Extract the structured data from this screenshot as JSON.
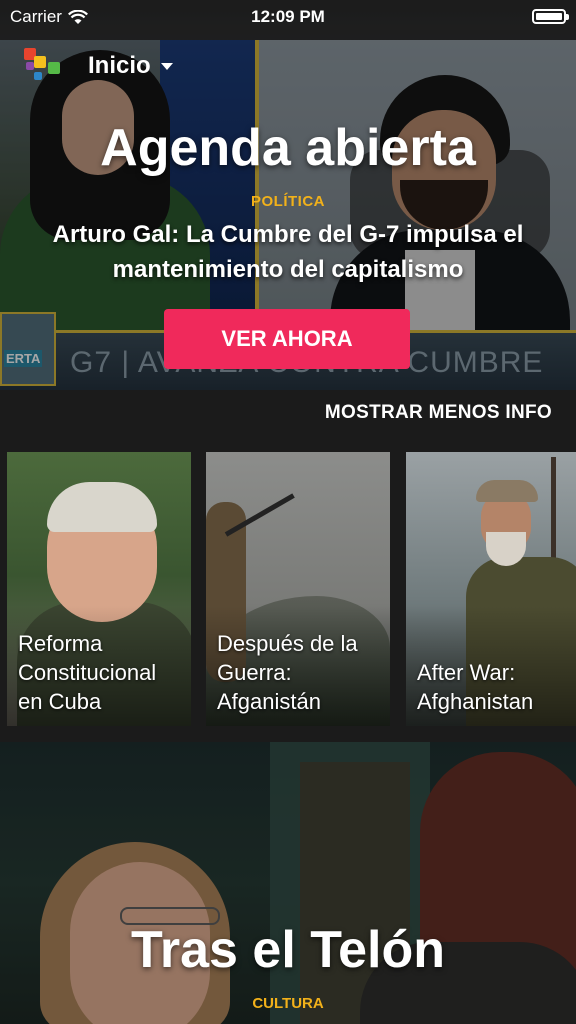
{
  "status_bar": {
    "carrier": "Carrier",
    "time": "12:09 PM"
  },
  "header": {
    "title": "Inicio",
    "logo_colors": [
      "#e8442e",
      "#f4c01e",
      "#55b947",
      "#2d87c9"
    ]
  },
  "featured": {
    "show_title": "Agenda abierta",
    "category": "POLÍTICA",
    "episode_title": "Arturo Gal: La Cumbre del G-7 impulsa el mantenimiento del capitalismo",
    "watch_button": "VER AHORA",
    "ticker_text": "G7 | AVANZA CONTRA CUMBRE",
    "ticker_logo": "ERTA"
  },
  "more_info_link": "MOSTRAR MENOS INFO",
  "cards": [
    {
      "title": "Reforma Constitucional en Cuba"
    },
    {
      "title": "Después de la Guerra: Afganistán"
    },
    {
      "title": "After War: Afghanistan"
    }
  ],
  "second_feature": {
    "show_title": "Tras el Telón",
    "category": "CULTURA"
  },
  "colors": {
    "accent": "#f0295b",
    "category": "#f2b11a",
    "background": "#1b1b1b"
  }
}
